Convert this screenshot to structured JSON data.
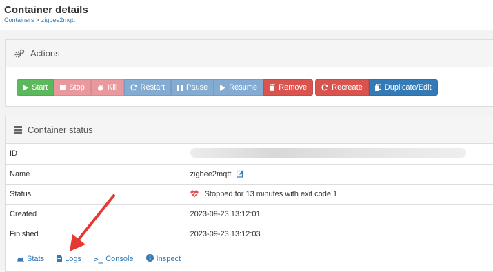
{
  "header": {
    "title": "Container details",
    "breadcrumb": {
      "parent": "Containers",
      "separator": ">",
      "current": "zigbee2mqtt"
    }
  },
  "actions": {
    "title": "Actions",
    "icon": "gears-icon",
    "buttons": {
      "start": "Start",
      "stop": "Stop",
      "kill": "Kill",
      "restart": "Restart",
      "pause": "Pause",
      "resume": "Resume",
      "remove": "Remove",
      "recreate": "Recreate",
      "duplicate": "Duplicate/Edit"
    }
  },
  "status": {
    "title": "Container status",
    "icon": "server-icon",
    "rows": {
      "id": {
        "label": "ID",
        "value": ""
      },
      "name": {
        "label": "Name",
        "value": "zigbee2mqtt"
      },
      "status": {
        "label": "Status",
        "value": "Stopped for 13 minutes with exit code 1"
      },
      "created": {
        "label": "Created",
        "value": "2023-09-23 13:12:01"
      },
      "finished": {
        "label": "Finished",
        "value": "2023-09-23 13:12:03"
      }
    },
    "links": {
      "stats": "Stats",
      "logs": "Logs",
      "console": "Console",
      "inspect": "Inspect"
    }
  },
  "colors": {
    "link": "#337ab7",
    "success": "#5cb85c",
    "danger": "#d9534f",
    "arrow": "#e53935"
  }
}
